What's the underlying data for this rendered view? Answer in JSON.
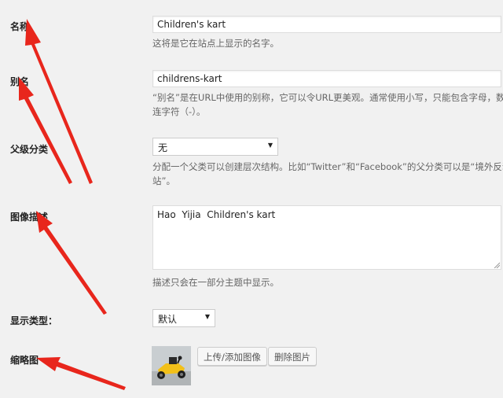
{
  "fields": {
    "name": {
      "label": "名称",
      "value": "Children's kart",
      "desc": "这将是它在站点上显示的名字。"
    },
    "slug": {
      "label": "别名",
      "value": "childrens-kart",
      "desc_line1": "“别名”是在URL中使用的别称，它可以令URL更美观。通常使用小写，只能包含字母，数字",
      "desc_line2": "连字符（-）。"
    },
    "parent": {
      "label": "父级分类",
      "selected": "无",
      "desc_line1": "分配一个父类可以创建层次结构。比如“Twitter”和“Facebook”的父分类可以是“境外反动网",
      "desc_line2": "站”。"
    },
    "description": {
      "label": "图像描述",
      "value": "Hao  Yijia  Children's kart",
      "desc": "描述只会在一部分主题中显示。"
    },
    "display_type": {
      "label": "显示类型：",
      "selected": "默认"
    },
    "thumbnail": {
      "label": "缩略图",
      "upload_label": "上传/添加图像",
      "remove_label": "删除图片"
    }
  },
  "colors": {
    "background": "#f1f1f1",
    "annotation_arrow": "#e8261c"
  }
}
